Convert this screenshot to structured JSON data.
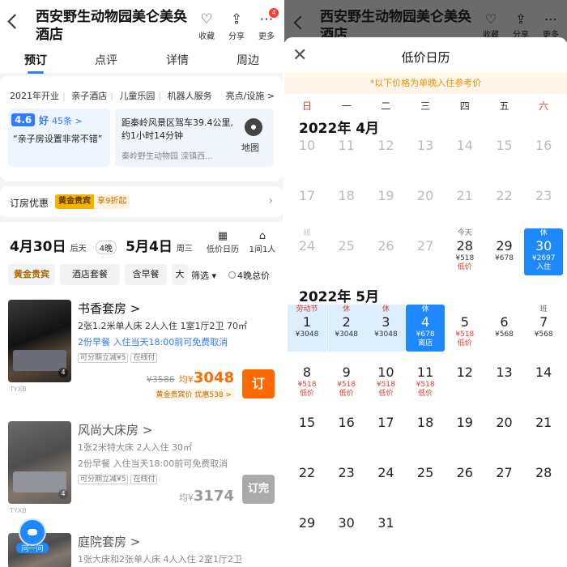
{
  "left": {
    "header": {
      "title": "西安野生动物园美仑美奂酒店",
      "actions": [
        {
          "label": "收藏",
          "glyph": "♡"
        },
        {
          "label": "分享",
          "glyph": "⇪"
        },
        {
          "label": "更多",
          "glyph": "⋯",
          "badge": "4"
        }
      ]
    },
    "tabs": [
      "预订",
      "点评",
      "详情",
      "周边"
    ],
    "info": {
      "tags": [
        "2021年开业",
        "亲子酒店",
        "儿童乐园",
        "机器人服务"
      ],
      "tags_more": "亮点/设施 >",
      "score": "4.6",
      "rating_word": "好",
      "review_count": "45条 >",
      "quote": "“亲子房设置非常不错”",
      "distance": "距秦岭风景区驾车39.4公里,约1小时14分钟",
      "address": "秦岭野生动物园 滦镇西...",
      "map_label": "地图"
    },
    "promo": {
      "label": "订房优惠",
      "gold": "黄金贵宾",
      "discount": "享9折起"
    },
    "dates": {
      "checkin": "4月30日",
      "checkin_day": "后天",
      "nights": "4晚",
      "checkout": "5月4日",
      "checkout_day": "周三",
      "calendar_label": "低价日历",
      "guests_label": "1间1人"
    },
    "filters": [
      "黄金贵宾",
      "酒店套餐",
      "含早餐",
      "大"
    ],
    "sort_label": "筛选 ▾",
    "four_night_label": "4晚总价",
    "rooms": [
      {
        "name": "书香套房 >",
        "specs": "2张1.2米单人床  2人入住  1室1厅2卫  70㎡",
        "policy": "2份早餐  入住当天18:00前可免费取消",
        "tags": [
          "可分期立减¥5",
          "在线付"
        ],
        "orig": "¥3586",
        "avg": "均¥",
        "price": "3048",
        "gold_note": "黄金贵宾价  优惠538 >",
        "book": "订"
      },
      {
        "name": "风尚大床房 >",
        "specs": "1张2米特大床  2人入住  30㎡",
        "policy": "2份早餐  入住当天18:00前可免费取消",
        "tags": [
          "可分期立减¥5",
          "在线付"
        ],
        "orig": "",
        "avg": "均¥",
        "price": "3174",
        "gold_note": "",
        "book": "订完"
      },
      {
        "name": "庭院套房 >",
        "specs": "1张大床和2张单人床  4人入住  2室1厅2卫",
        "policy": "",
        "tags": [],
        "orig": "",
        "avg": "",
        "price": "",
        "gold_note": "",
        "book": ""
      }
    ],
    "watermark": "TYXB",
    "assistant_label": "问一问"
  },
  "right": {
    "sheet_title": "低价日历",
    "note": "*以下价格为单晚入住参考价",
    "weekdays": [
      "日",
      "一",
      "二",
      "三",
      "四",
      "五",
      "六"
    ],
    "months": [
      {
        "label": "2022年 4月",
        "start_col": 0,
        "days": [
          {
            "d": "10",
            "past": true
          },
          {
            "d": "11",
            "past": true
          },
          {
            "d": "12",
            "past": true
          },
          {
            "d": "13",
            "past": true
          },
          {
            "d": "14",
            "past": true
          },
          {
            "d": "15",
            "past": true
          },
          {
            "d": "16",
            "past": true
          },
          {
            "d": "17",
            "past": true
          },
          {
            "d": "18",
            "past": true
          },
          {
            "d": "19",
            "past": true
          },
          {
            "d": "20",
            "past": true
          },
          {
            "d": "21",
            "past": true
          },
          {
            "d": "22",
            "past": true
          },
          {
            "d": "23",
            "past": true
          },
          {
            "d": "24",
            "past": true,
            "top": "班"
          },
          {
            "d": "25",
            "past": true
          },
          {
            "d": "26",
            "past": true
          },
          {
            "d": "27",
            "past": true
          },
          {
            "d": "28",
            "top": "今天",
            "p": "¥518",
            "s": "低价"
          },
          {
            "d": "29",
            "p": "¥678"
          },
          {
            "d": "30",
            "top": "休",
            "p": "¥2697",
            "s": "入住",
            "sel": true
          }
        ]
      },
      {
        "label": "2022年 5月",
        "start_col": 0,
        "days": [
          {
            "d": "1",
            "top": "劳动节",
            "p": "¥3048",
            "hol": true
          },
          {
            "d": "2",
            "top": "休",
            "p": "¥3048",
            "hol": true
          },
          {
            "d": "3",
            "top": "休",
            "p": "¥3048",
            "hol": true
          },
          {
            "d": "4",
            "top": "休",
            "p": "¥678",
            "s": "离店",
            "sel": true
          },
          {
            "d": "5",
            "p": "¥518",
            "s": "低价",
            "low": true
          },
          {
            "d": "6",
            "p": "¥568"
          },
          {
            "d": "7",
            "top": "班",
            "p": "¥568"
          },
          {
            "d": "8",
            "p": "¥518",
            "s": "低价",
            "low": true
          },
          {
            "d": "9",
            "p": "¥518",
            "s": "低价",
            "low": true
          },
          {
            "d": "10",
            "p": "¥518",
            "s": "低价",
            "low": true
          },
          {
            "d": "11",
            "p": "¥518",
            "s": "低价",
            "low": true
          },
          {
            "d": "12"
          },
          {
            "d": "13"
          },
          {
            "d": "14"
          },
          {
            "d": "15"
          },
          {
            "d": "16"
          },
          {
            "d": "17"
          },
          {
            "d": "18"
          },
          {
            "d": "19"
          },
          {
            "d": "20"
          },
          {
            "d": "21"
          },
          {
            "d": "22"
          },
          {
            "d": "23"
          },
          {
            "d": "24"
          },
          {
            "d": "25"
          },
          {
            "d": "26"
          },
          {
            "d": "27"
          },
          {
            "d": "28"
          },
          {
            "d": "29"
          },
          {
            "d": "30"
          },
          {
            "d": "31"
          }
        ]
      }
    ]
  }
}
